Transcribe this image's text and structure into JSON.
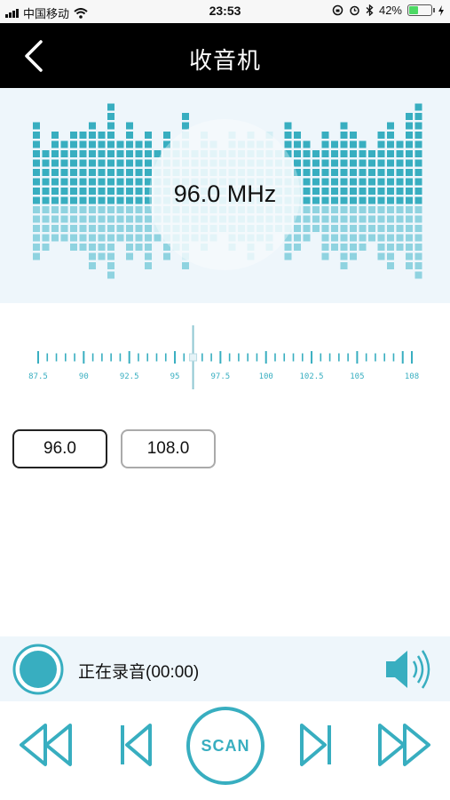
{
  "status_bar": {
    "carrier": "中国移动",
    "time": "23:53",
    "battery": "42%",
    "battery_level": 0.42
  },
  "nav": {
    "title": "收音机",
    "back_icon": "chevron-left-icon"
  },
  "display": {
    "frequency": "96.0 MHz"
  },
  "dial": {
    "min": 87.5,
    "max": 108,
    "current": 96.0,
    "tick_labels": [
      "87.5",
      "90",
      "92.5",
      "95",
      "97.5",
      "100",
      "102.5",
      "105",
      "108"
    ]
  },
  "presets": [
    "96.0",
    "108.0"
  ],
  "recording": {
    "status": "正在录音(00:00)",
    "speaker_icon": "speaker-icon"
  },
  "controls": {
    "scan_label": "SCAN"
  },
  "colors": {
    "accent": "#38aec0",
    "accent_light": "#8fd3e0",
    "nav_bg": "#000000",
    "panel_bg": "#eef6fb"
  }
}
